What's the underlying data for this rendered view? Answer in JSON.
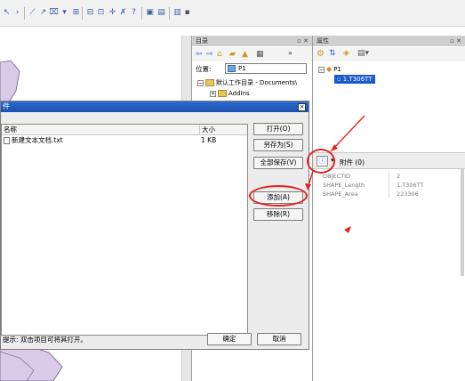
{
  "toolbar": {
    "icons": [
      "arrow-icon",
      "chevron-icon",
      "line-icon",
      "curve-icon",
      "sketch-icon",
      "split-icon",
      "grid-icon",
      "table-icon",
      "crosshair-icon",
      "edit-icon",
      "help-icon",
      "window-icon",
      "image-icon",
      "layout-icon"
    ]
  },
  "catalog": {
    "title": "目录",
    "location_label": "位置:",
    "location_value": "P1",
    "tree": [
      {
        "label": "默认工作目录 - Documents\\"
      },
      {
        "label": "AddIns"
      }
    ]
  },
  "attributes": {
    "title": "属性",
    "tree_root": "P1",
    "tree_child": "1.T306TT",
    "attachments_label": "附件 (0)",
    "fields": [
      {
        "name": "OBJECTID",
        "value": "2"
      },
      {
        "name": "SHAPE_Length",
        "value": "1.T306TT"
      },
      {
        "name": "SHAPE_Area",
        "value": "223306"
      }
    ]
  },
  "dialog": {
    "title": "件",
    "close_glyph": "×",
    "columns": {
      "name": "名称",
      "size": "大小"
    },
    "files": [
      {
        "name": "新建文本文档.txt",
        "size": "1 KB"
      }
    ],
    "buttons": {
      "open": "打开(O)",
      "save_as": "另存为(S)",
      "save_all": "全部保存(V)",
      "add": "添加(A)",
      "remove": "移除(R)",
      "ok": "确定",
      "cancel": "取消"
    },
    "hint": "提示: 双击项目可将其打开。"
  },
  "colors": {
    "highlight": "#e32222",
    "title_bar": "#1c4fae"
  }
}
